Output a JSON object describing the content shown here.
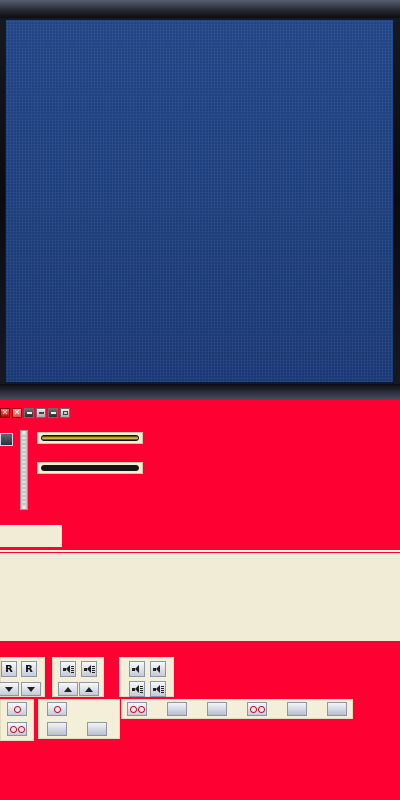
{
  "monitor": {
    "screen_color": "#1d3d7a"
  },
  "colors": {
    "background": "#ff0033",
    "panel": "#f0ecd5",
    "accent_gold": "#d8b02c"
  },
  "icon_strip": [
    {
      "icon": "close-icon"
    },
    {
      "icon": "close-alt-icon"
    },
    {
      "icon": "minimize-icon"
    },
    {
      "icon": "restore-icon"
    },
    {
      "icon": "maximize-icon"
    },
    {
      "icon": "window-icon"
    }
  ],
  "toolbar": {
    "record_label": "R",
    "record_label_2": "R"
  }
}
